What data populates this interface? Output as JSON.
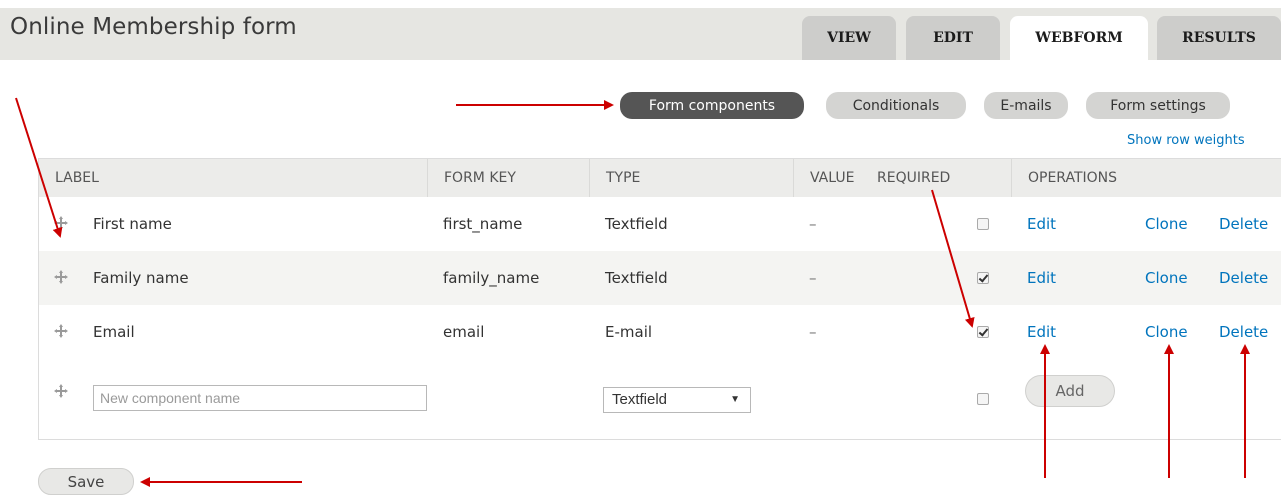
{
  "page": {
    "title": "Online Membership form"
  },
  "tabs": {
    "view": "VIEW",
    "edit": "EDIT",
    "webform": "WEBFORM",
    "results": "RESULTS"
  },
  "subtabs": {
    "form_components": "Form components",
    "conditionals": "Conditionals",
    "emails": "E-mails",
    "form_settings": "Form settings"
  },
  "show_row_weights": "Show row weights",
  "table": {
    "headers": {
      "label": "LABEL",
      "form_key": "FORM KEY",
      "type": "TYPE",
      "value": "VALUE",
      "required": "REQUIRED",
      "operations": "OPERATIONS"
    },
    "rows": [
      {
        "label": "First name",
        "form_key": "first_name",
        "type": "Textfield",
        "value": "–",
        "required": false,
        "edit": "Edit",
        "clone": "Clone",
        "delete": "Delete"
      },
      {
        "label": "Family name",
        "form_key": "family_name",
        "type": "Textfield",
        "value": "–",
        "required": true,
        "edit": "Edit",
        "clone": "Clone",
        "delete": "Delete"
      },
      {
        "label": "Email",
        "form_key": "email",
        "type": "E-mail",
        "value": "–",
        "required": true,
        "edit": "Edit",
        "clone": "Clone",
        "delete": "Delete"
      }
    ],
    "new_component": {
      "placeholder": "New component name",
      "type_selected": "Textfield",
      "required": false,
      "add_label": "Add"
    }
  },
  "save_label": "Save",
  "icons": {
    "drag": "drag-handle-icon",
    "dropdown": "chevron-down-icon"
  },
  "colors": {
    "active_subtab": "#555555",
    "link": "#0074bd",
    "arrow": "#cc0000"
  }
}
